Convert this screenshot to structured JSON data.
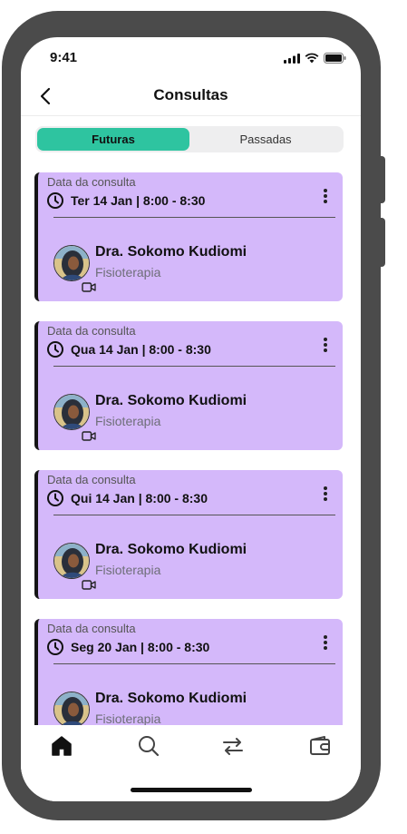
{
  "status": {
    "time": "9:41"
  },
  "header": {
    "title": "Consultas"
  },
  "segments": {
    "active": "Futuras",
    "inactive": "Passadas"
  },
  "appointments": [
    {
      "label": "Data da consulta",
      "date": "Ter 14 Jan | 8:00 - 8:30",
      "doctor": "Dra. Sokomo Kudiomi",
      "specialty": "Fisioterapia"
    },
    {
      "label": "Data da consulta",
      "date": "Qua 14 Jan | 8:00 - 8:30",
      "doctor": "Dra. Sokomo Kudiomi",
      "specialty": "Fisioterapia"
    },
    {
      "label": "Data da consulta",
      "date": "Qui 14 Jan | 8:00 - 8:30",
      "doctor": "Dra. Sokomo Kudiomi",
      "specialty": "Fisioterapia"
    },
    {
      "label": "Data da consulta",
      "date": "Seg 20 Jan | 8:00 - 8:30",
      "doctor": "Dra. Sokomo Kudiomi",
      "specialty": "Fisioterapia"
    }
  ],
  "colors": {
    "accent": "#2ec4a0",
    "card": "#d4b8fa",
    "frame": "#4b4b4b"
  },
  "tabbar": {
    "icons": [
      "home-icon",
      "search-icon",
      "transfer-icon",
      "wallet-icon"
    ]
  }
}
